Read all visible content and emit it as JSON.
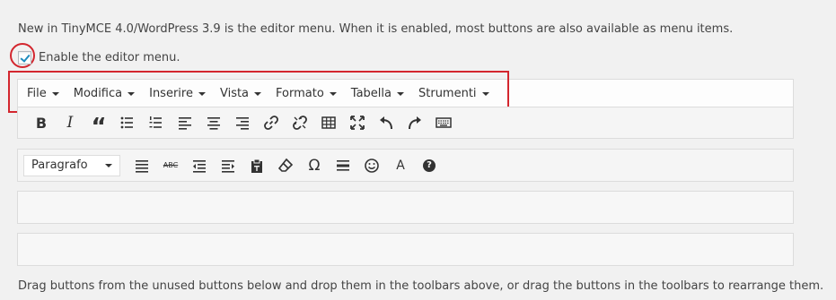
{
  "intro_text": "New in TinyMCE 4.0/WordPress 3.9 is the editor menu. When it is enabled, most buttons are also available as menu items.",
  "checkbox_label": "Enable the editor menu.",
  "menu_items": [
    "File",
    "Modifica",
    "Inserire",
    "Vista",
    "Formato",
    "Tabella",
    "Strumenti"
  ],
  "toolbar1": {
    "bold_text": "B",
    "italic_text": "I",
    "blockquote_text": "“"
  },
  "toolbar2": {
    "format_select_value": "Paragrafo",
    "strikethrough_text": "ABC",
    "omega_text": "Ω",
    "text_color_text": "A",
    "help_text": "?"
  },
  "footer_text": "Drag buttons from the unused buttons below and drop them in the toolbars above, or drag the buttons in the toolbars to rearrange them."
}
